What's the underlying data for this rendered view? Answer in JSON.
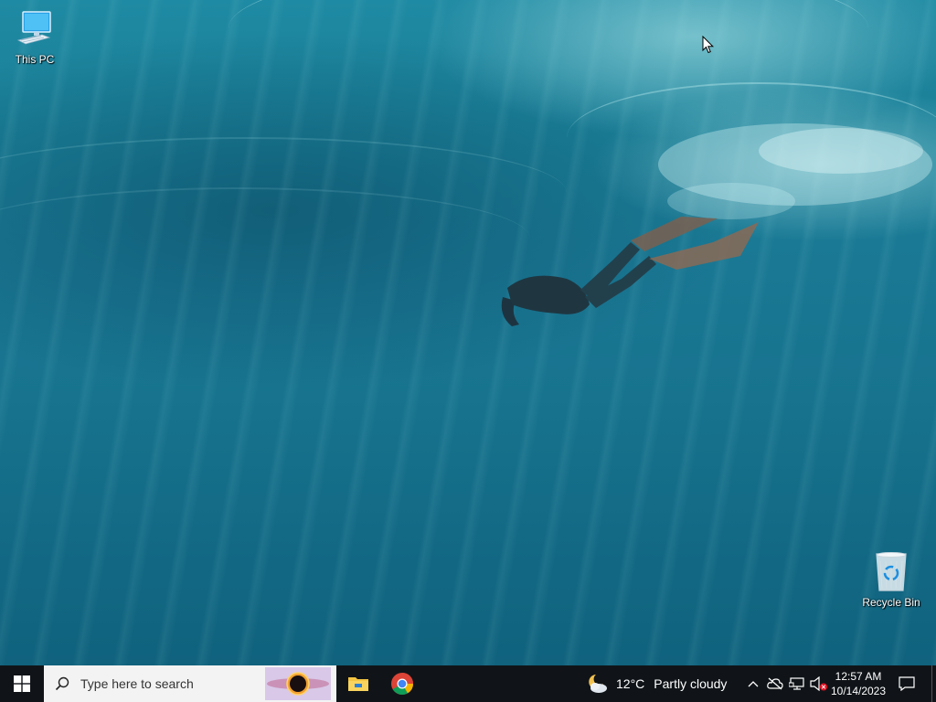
{
  "desktop": {
    "icons": [
      {
        "label": "This PC",
        "icon": "computer-icon"
      },
      {
        "label": "Recycle Bin",
        "icon": "recycle-bin-icon"
      }
    ]
  },
  "taskbar": {
    "start_icon": "windows-logo-icon",
    "search": {
      "placeholder": "Type here to search",
      "icon": "search-icon"
    },
    "pinned_apps": [
      {
        "name": "File Explorer",
        "icon": "folder-icon"
      },
      {
        "name": "Google Chrome",
        "icon": "chrome-icon"
      }
    ],
    "weather": {
      "temperature": "12°C",
      "condition": "Partly cloudy",
      "icon": "partly-cloudy-night-icon"
    },
    "tray": {
      "icons": [
        "chevron-up-icon",
        "onedrive-offline-icon",
        "network-icon",
        "volume-muted-icon"
      ]
    },
    "clock": {
      "time": "12:57 AM",
      "date": "10/14/2023"
    },
    "notification_icon": "notification-icon"
  },
  "colors": {
    "taskbar_bg": "#101418",
    "search_bg": "#f3f3f3",
    "start_accent": "#ffffff"
  }
}
